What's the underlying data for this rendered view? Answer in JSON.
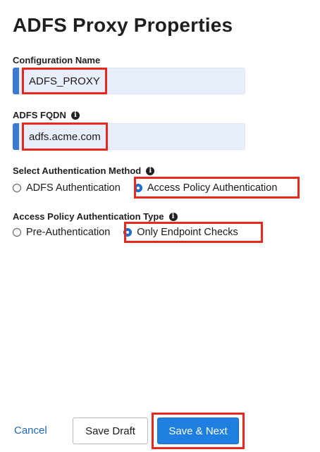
{
  "page": {
    "title": "ADFS Proxy Properties"
  },
  "config_name": {
    "label": "Configuration Name",
    "value": "ADFS_PROXY"
  },
  "fqdn": {
    "label": "ADFS FQDN",
    "value": "adfs.acme.com",
    "info_icon": "info-icon"
  },
  "auth_method": {
    "label": "Select Authentication Method",
    "info_icon": "info-icon",
    "options": [
      {
        "label": "ADFS Authentication",
        "selected": false
      },
      {
        "label": "Access Policy Authentication",
        "selected": true
      }
    ]
  },
  "auth_type": {
    "label": "Access Policy Authentication Type",
    "info_icon": "info-icon",
    "options": [
      {
        "label": "Pre-Authentication",
        "selected": false
      },
      {
        "label": "Only Endpoint Checks",
        "selected": true
      }
    ]
  },
  "footer": {
    "cancel_label": "Cancel",
    "save_draft_label": "Save Draft",
    "save_next_label": "Save & Next"
  },
  "colors": {
    "accent_blue": "#1f7fe0",
    "field_background": "#e8eefc",
    "field_accent": "#3d7bd0",
    "highlight_red": "#e8281e",
    "link_blue": "#2167b8"
  }
}
